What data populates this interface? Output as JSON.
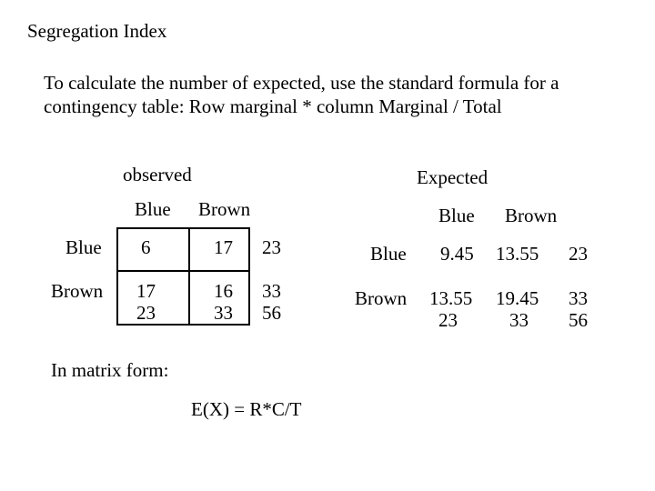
{
  "title": "Segregation Index",
  "description": "To calculate the number of expected, use the standard formula for a contingency table: Row marginal * column Marginal / Total",
  "observed": {
    "label": "observed",
    "col_labels": {
      "blue": "Blue",
      "brown": "Brown"
    },
    "row_labels": {
      "blue": "Blue",
      "brown": "Brown"
    },
    "cells": {
      "r1c1": "6",
      "r1c2": "17",
      "r1m": "23",
      "r2c1a": "17",
      "r2c1b": "23",
      "r2c2a": "16",
      "r2c2b": "33",
      "r2ma": "33",
      "r2mb": "56"
    }
  },
  "expected": {
    "label": "Expected",
    "col_labels": {
      "blue": "Blue",
      "brown": "Brown"
    },
    "row_labels": {
      "blue": "Blue",
      "brown": "Brown"
    },
    "cells": {
      "r1c1": "9.45",
      "r1c2": "13.55",
      "r1m": "23",
      "r2c1a": "13.55",
      "r2c1b": "23",
      "r2c2a": "19.45",
      "r2c2b": "33",
      "r2ma": "33",
      "r2mb": "56"
    }
  },
  "matrix_label": "In matrix form:",
  "formula": "E(X) = R*C/T",
  "chart_data": [
    {
      "type": "table",
      "title": "observed",
      "row_labels": [
        "Blue",
        "Brown"
      ],
      "col_labels": [
        "Blue",
        "Brown"
      ],
      "values": [
        [
          6,
          17
        ],
        [
          17,
          16
        ]
      ],
      "row_marginals": [
        23,
        33
      ],
      "col_marginals": [
        23,
        33
      ],
      "total": 56
    },
    {
      "type": "table",
      "title": "Expected",
      "row_labels": [
        "Blue",
        "Brown"
      ],
      "col_labels": [
        "Blue",
        "Brown"
      ],
      "values": [
        [
          9.45,
          13.55
        ],
        [
          13.55,
          19.45
        ]
      ],
      "row_marginals": [
        23,
        33
      ],
      "col_marginals": [
        23,
        33
      ],
      "total": 56
    }
  ]
}
